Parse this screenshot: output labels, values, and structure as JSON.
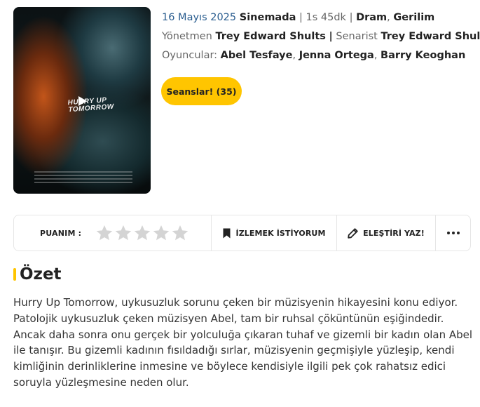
{
  "poster": {
    "title_lines": [
      "HURRY UP",
      "TOMORROW"
    ],
    "icon": "play-icon"
  },
  "info": {
    "release_date": "16 Mayıs 2025",
    "status": "Sinemada",
    "separator": "|",
    "duration": "1s 45dk",
    "genre_1": "Dram",
    "genre_2": "Gerilim",
    "director_label": "Yönetmen",
    "director": "Trey Edward Shults",
    "writer_label": "Senarist",
    "writer": "Trey Edward Shults",
    "cast_label": "Oyuncular:",
    "cast": [
      "Abel Tesfaye",
      "Jenna Ortega",
      "Barry Keoghan"
    ]
  },
  "sessions_button": {
    "label": "Seanslar! (35)"
  },
  "actions": {
    "rating_label": "PUANIM :",
    "stars_filled": 0,
    "stars_total": 5,
    "watchlist_label": "İZLEMEK İSTİYORUM",
    "review_label": "ELEŞTİRİ YAZ!",
    "icons": [
      "star-icon",
      "bookmark-icon",
      "pencil-icon",
      "more-icon"
    ]
  },
  "summary": {
    "title": "Özet",
    "text": "Hurry Up Tomorrow, uykusuzluk sorunu çeken bir müzisyenin hikayesini konu ediyor. Patolojik uykusuzluk çeken müzisyen Abel, tam bir ruhsal çöküntünün eşiğindedir. Ancak daha sonra onu gerçek bir yolculuğa çıkaran tuhaf ve gizemli bir kadın olan Abel ile tanışır. Bu gizemli kadının fısıldadığı sırlar, müzisyenin geçmişiyle yüzleşip, kendi kimliğinin derinliklerine inmesine ve böylece kendisiyle ilgili pek çok rahatsız edici soruyla yüzleşmesine neden olur."
  },
  "colors": {
    "accent": "#ffc500",
    "date_blue": "#2a5d8f",
    "star_empty": "#d4d4d4",
    "border": "#e6e6e6"
  }
}
